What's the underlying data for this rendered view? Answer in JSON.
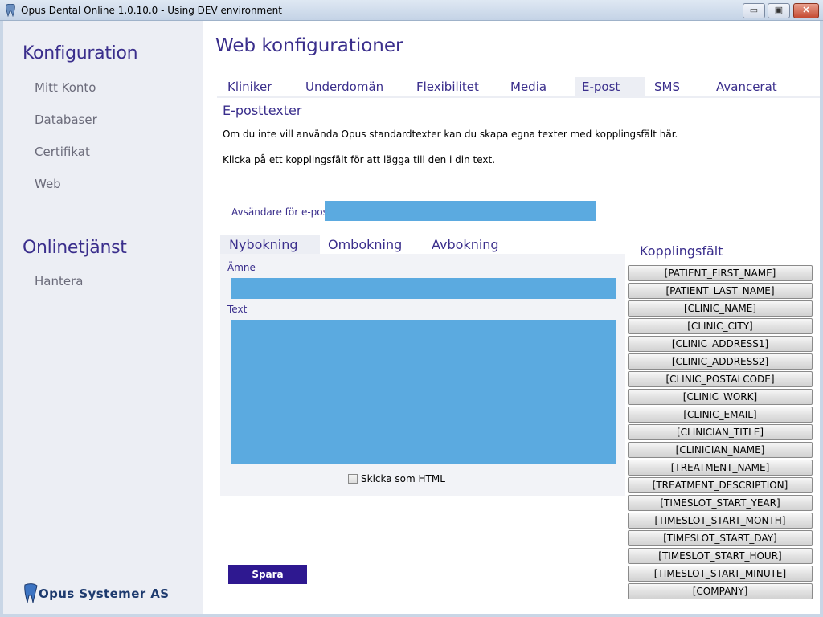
{
  "window": {
    "title": "Opus Dental Online 1.0.10.0 - Using DEV environment",
    "min_label": "▭",
    "max_label": "▣",
    "close_label": "✕"
  },
  "sidebar": {
    "heading1": "Konfiguration",
    "items1": [
      {
        "label": "Mitt Konto"
      },
      {
        "label": "Databaser"
      },
      {
        "label": "Certifikat"
      },
      {
        "label": "Web"
      }
    ],
    "heading2": "Onlinetjänst",
    "items2": [
      {
        "label": "Hantera"
      }
    ],
    "logo_text": "Opus Systemer AS"
  },
  "main": {
    "title": "Web konfigurationer",
    "tabs": [
      {
        "label": "Kliniker"
      },
      {
        "label": "Underdomän"
      },
      {
        "label": "Flexibilitet"
      },
      {
        "label": "Media"
      },
      {
        "label": "E-post"
      },
      {
        "label": "SMS"
      },
      {
        "label": "Avancerat"
      }
    ],
    "active_tab": "E-post",
    "section_title": "E-posttexter",
    "desc1": "Om du inte vill använda Opus standardtexter kan du skapa egna texter med kopplingsfält här.",
    "desc2": "Klicka på ett kopplingsfält för att lägga till den i din text.",
    "sender_label": "Avsändare för e-post",
    "sender_value": "",
    "subtabs": [
      {
        "label": "Nybokning"
      },
      {
        "label": "Ombokning"
      },
      {
        "label": "Avbokning"
      }
    ],
    "active_subtab": "Nybokning",
    "subject_label": "Ämne",
    "subject_value": "",
    "text_label": "Text",
    "text_value": "",
    "html_checkbox_label": "Skicka som HTML",
    "html_checkbox_checked": false,
    "save_label": "Spara"
  },
  "kopplingsfalt": {
    "title": "Kopplingsfält",
    "fields": [
      "[PATIENT_FIRST_NAME]",
      "[PATIENT_LAST_NAME]",
      "[CLINIC_NAME]",
      "[CLINIC_CITY]",
      "[CLINIC_ADDRESS1]",
      "[CLINIC_ADDRESS2]",
      "[CLINIC_POSTALCODE]",
      "[CLINIC_WORK]",
      "[CLINIC_EMAIL]",
      "[CLINICIAN_TITLE]",
      "[CLINICIAN_NAME]",
      "[TREATMENT_NAME]",
      "[TREATMENT_DESCRIPTION]",
      "[TIMESLOT_START_YEAR]",
      "[TIMESLOT_START_MONTH]",
      "[TIMESLOT_START_DAY]",
      "[TIMESLOT_START_HOUR]",
      "[TIMESLOT_START_MINUTE]",
      "[COMPANY]"
    ]
  },
  "colors": {
    "accent": "#3a2e8c",
    "input_blue": "#5baae0",
    "save_button": "#2e1890",
    "sidebar_bg": "#eceef4"
  }
}
